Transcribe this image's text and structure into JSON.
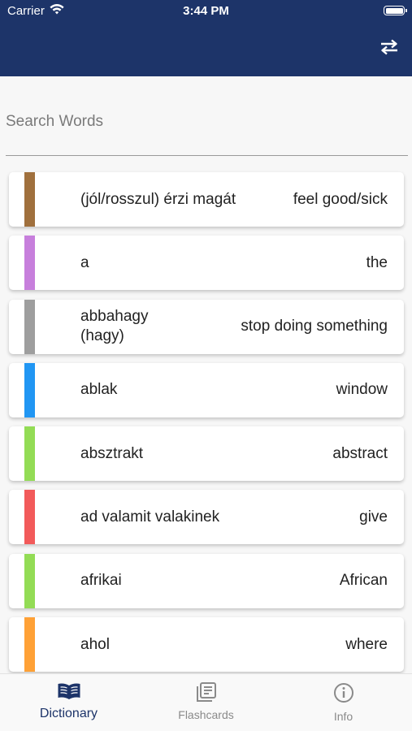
{
  "status_bar": {
    "carrier": "Carrier",
    "time": "3:44 PM"
  },
  "header": {
    "swap_icon": "swap-horizontal-icon"
  },
  "search": {
    "placeholder": "Search Words",
    "value": ""
  },
  "words": [
    {
      "hu": "(jól/rosszul) érzi magát",
      "en": "feel good/sick",
      "color": "#a0703d"
    },
    {
      "hu": "a",
      "en": "the",
      "color": "#c77fdc"
    },
    {
      "hu": "abbahagy\n(hagy)",
      "en": "stop doing something",
      "color": "#9e9e9e"
    },
    {
      "hu": "ablak",
      "en": "window",
      "color": "#2196f3"
    },
    {
      "hu": "absztrakt",
      "en": "abstract",
      "color": "#93dc55"
    },
    {
      "hu": "ad valamit valakinek",
      "en": "give",
      "color": "#f25a5a"
    },
    {
      "hu": "afrikai",
      "en": "African",
      "color": "#93dc55"
    },
    {
      "hu": "ahol",
      "en": "where",
      "color": "#ffa136"
    }
  ],
  "nav": {
    "dictionary": "Dictionary",
    "flashcards": "Flashcards",
    "info": "Info"
  },
  "colors": {
    "brand": "#1d3469",
    "inactive_tab": "#8a8a8a"
  }
}
